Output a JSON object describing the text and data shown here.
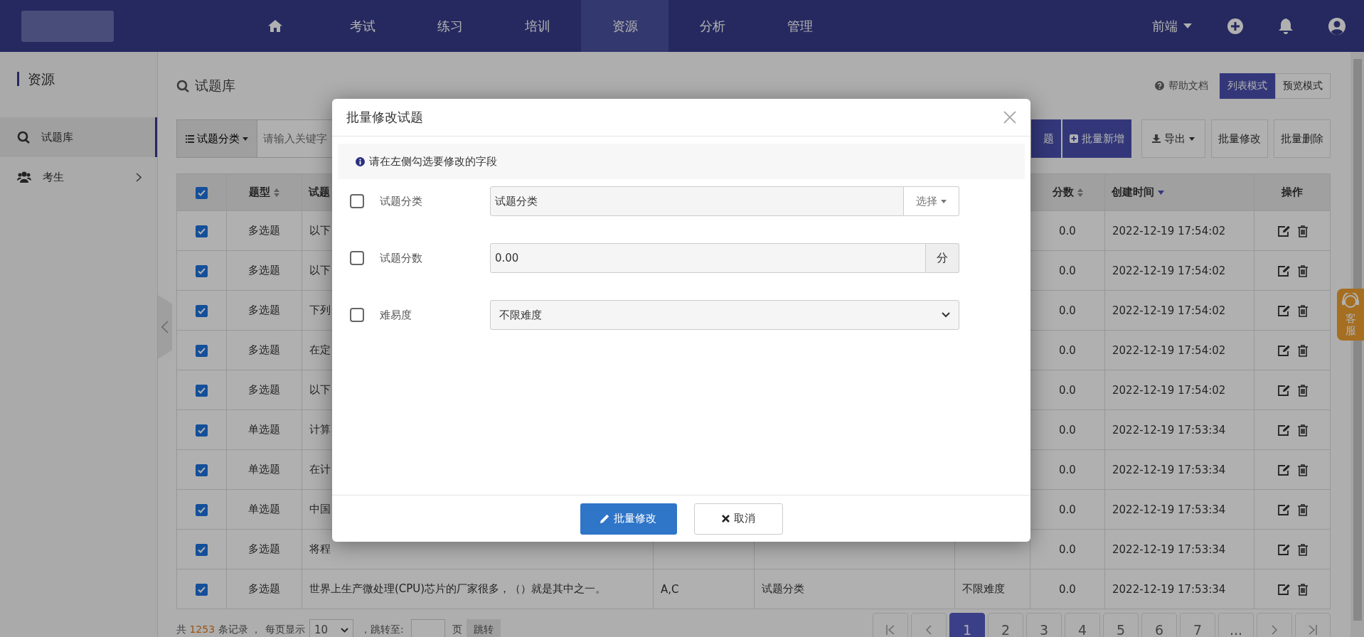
{
  "nav": {
    "items": [
      {
        "kind": "home",
        "selected": false
      },
      {
        "kind": "text",
        "label": "考试",
        "selected": false
      },
      {
        "kind": "text",
        "label": "练习",
        "selected": false
      },
      {
        "kind": "text",
        "label": "培训",
        "selected": false
      },
      {
        "kind": "text",
        "label": "资源",
        "selected": true
      },
      {
        "kind": "text",
        "label": "分析",
        "selected": false
      },
      {
        "kind": "text",
        "label": "管理",
        "selected": false
      }
    ],
    "user_menu": "前端"
  },
  "sidebar": {
    "title": "资源",
    "items": [
      {
        "kind": "bank",
        "label": "试题库",
        "selected": true
      },
      {
        "kind": "group",
        "label": "考生",
        "selected": false
      }
    ]
  },
  "page": {
    "title": "试题库",
    "help_link": "帮助文档",
    "view_modes": [
      {
        "label": "列表模式",
        "selected": true
      },
      {
        "label": "预览模式",
        "selected": false
      }
    ]
  },
  "toolbar": {
    "category_button": "试题分类",
    "search": {
      "placeholder": "请输入关键字"
    },
    "buttons": [
      {
        "kind": "partial",
        "label": "题"
      },
      {
        "kind": "add",
        "label": "批量新增"
      },
      {
        "kind": "export",
        "label": "导出"
      },
      {
        "kind": "plain",
        "label": "批量修改"
      },
      {
        "kind": "plain",
        "label": "批量删除"
      }
    ]
  },
  "table": {
    "select_all": {
      "checked": true
    },
    "header": [
      {
        "label": "题型",
        "sortable": true,
        "sorted_desc": false
      },
      {
        "label": "试题",
        "sortable": false,
        "sorted_desc": false
      },
      {
        "label": "分数",
        "sortable": true,
        "sorted_desc": false
      },
      {
        "label": "创建时间",
        "sortable": false,
        "sorted_desc": true
      },
      {
        "label": "操作",
        "sortable": false,
        "sorted_desc": false
      }
    ],
    "rows": [
      {
        "checked": true,
        "type": "多选题",
        "stem": "以下",
        "score": "0.0",
        "created": "2022-12-19 17:54:02"
      },
      {
        "checked": true,
        "type": "多选题",
        "stem": "以下",
        "score": "0.0",
        "created": "2022-12-19 17:54:02"
      },
      {
        "checked": true,
        "type": "多选题",
        "stem": "下列",
        "score": "0.0",
        "created": "2022-12-19 17:54:02"
      },
      {
        "checked": true,
        "type": "多选题",
        "stem": "在定",
        "score": "0.0",
        "created": "2022-12-19 17:54:02"
      },
      {
        "checked": true,
        "type": "多选题",
        "stem": "以下",
        "score": "0.0",
        "created": "2022-12-19 17:54:02"
      },
      {
        "checked": true,
        "type": "单选题",
        "stem": "计算",
        "score": "0.0",
        "created": "2022-12-19 17:53:34"
      },
      {
        "checked": true,
        "type": "单选题",
        "stem": "在计",
        "score": "0.0",
        "created": "2022-12-19 17:53:34"
      },
      {
        "checked": true,
        "type": "单选题",
        "stem": "中国",
        "score": "0.0",
        "created": "2022-12-19 17:53:34"
      },
      {
        "checked": true,
        "type": "多选题",
        "stem": "将程",
        "score": "0.0",
        "created": "2022-12-19 17:53:34"
      },
      {
        "checked": true,
        "type": "多选题",
        "stem": "世界上生产微处理(CPU)芯片的厂家很多，（）就是其中之一。",
        "answer": "A,C",
        "category": "试题分类",
        "difficulty": "不限难度",
        "score": "0.0",
        "created": "2022-12-19 17:53:34"
      }
    ]
  },
  "footer": {
    "total_prefix": "共",
    "total": "1253",
    "total_suffix": "条记录 ，",
    "per_page_label": "每页显示",
    "per_page": "10",
    "jump_label": "，跳转至:",
    "page_unit": "页",
    "jump_button": "跳转"
  },
  "pagination": [
    {
      "label": "1",
      "selected": true
    },
    {
      "label": "2",
      "selected": false
    },
    {
      "label": "3",
      "selected": false
    },
    {
      "label": "4",
      "selected": false
    },
    {
      "label": "5",
      "selected": false
    },
    {
      "label": "6",
      "selected": false
    },
    {
      "label": "7",
      "selected": false
    },
    {
      "label": "...",
      "selected": false
    }
  ],
  "support_tab": "客服",
  "modal": {
    "title": "批量修改试题",
    "info": "请在左侧勾选要修改的字段",
    "fields": [
      {
        "kind": "picker",
        "label": "试题分类",
        "checked": false,
        "value": "试题分类",
        "button": "选择"
      },
      {
        "kind": "addon",
        "label": "试题分数",
        "checked": false,
        "value": "0.00",
        "addon": "分"
      },
      {
        "kind": "select",
        "label": "难易度",
        "checked": false,
        "value": "不限难度"
      }
    ],
    "buttons": [
      {
        "kind": "primary",
        "label": "批量修改"
      },
      {
        "kind": "cancel",
        "label": "取消"
      }
    ]
  }
}
